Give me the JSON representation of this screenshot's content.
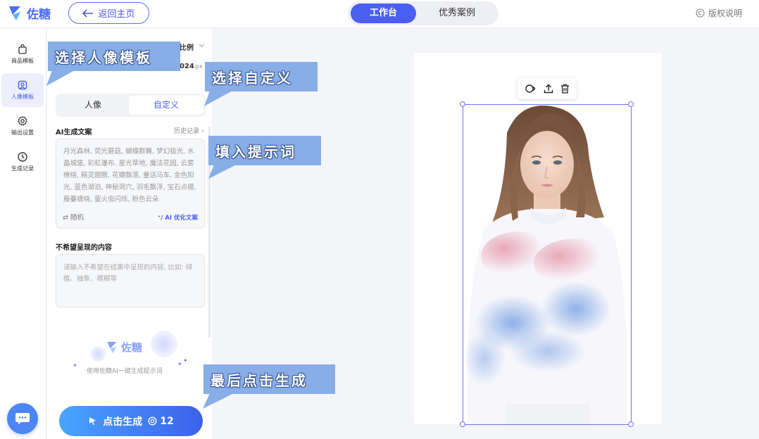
{
  "header": {
    "logo_text": "佐糖",
    "back_label": "返回主页",
    "tabs": [
      {
        "label": "工作台",
        "active": true
      },
      {
        "label": "优秀案例",
        "active": false
      }
    ],
    "copyright_label": "版权说明"
  },
  "sidebar": {
    "items": [
      {
        "label": "商品模板",
        "icon": "bag-icon",
        "active": false
      },
      {
        "label": "人像模板",
        "icon": "portrait-icon",
        "active": true
      },
      {
        "label": "输出设置",
        "icon": "gear-icon",
        "active": false
      },
      {
        "label": "生成记录",
        "icon": "clock-icon",
        "active": false
      }
    ]
  },
  "panel": {
    "ratio_label": "比例",
    "size_label": "024",
    "size_unit": "px",
    "segment": {
      "options": [
        "人像",
        "自定义"
      ],
      "selected": "自定义"
    },
    "prompt_title": "AI生成文案",
    "history_label": "历史记录",
    "prompt_text": "月光森林, 荧光蘑菇, 蝴蝶群舞, 梦幻极光, 水晶城堡, 彩虹瀑布, 星光草地, 魔法花园, 云雾缭绕, 精灵翅膀, 花瓣飘落, 童话马车, 金色阳光, 蓝色湖泊, 神秘洞穴, 羽毛飘浮, 宝石点缀, 藤蔓缠绕, 萤火虫闪烁, 粉色云朵",
    "random_label": "随机",
    "optimize_label": "AI 优化文案",
    "negative_title": "不希望呈现的内容",
    "negative_placeholder": "请输入不希望在结果中呈现的内容, 比如: 绿植、抽象、模糊等",
    "brand_watermark": "佐糖",
    "brand_sub": "使用佐糖AI一键生成提示词",
    "generate_label": "点击生成",
    "generate_cost": "12"
  },
  "callouts": {
    "choose_template": "选择人像模板",
    "choose_custom": "选择自定义",
    "fill_prompt": "填入提示词",
    "click_generate": "最后点击生成"
  },
  "colors": {
    "accent": "#4b5ff3",
    "callout": "#87aee6",
    "generate_start": "#49a4ff",
    "generate_end": "#3c62ea"
  }
}
